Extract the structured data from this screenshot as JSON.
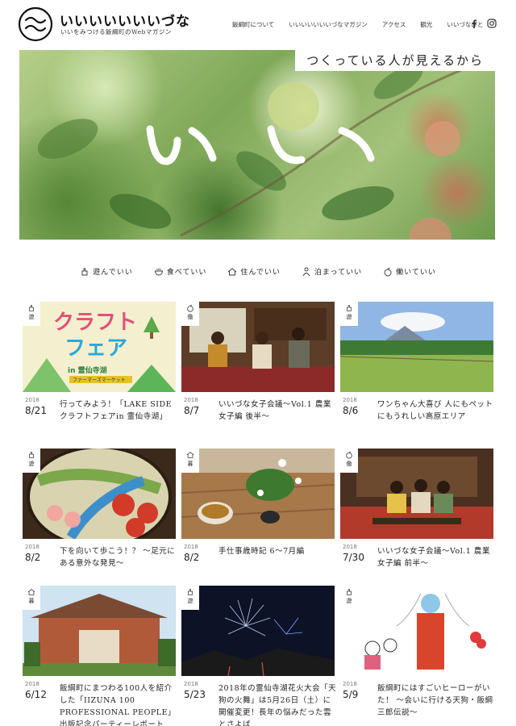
{
  "site": {
    "title": "いいいいいいいづな",
    "subtitle": "いいをみつける飯綱町のWebマガジン"
  },
  "nav": {
    "items": [
      {
        "label": "飯綱町について"
      },
      {
        "label": "いいいいいいいづなマガジン"
      },
      {
        "label": "アクセス"
      },
      {
        "label": "観光"
      },
      {
        "label": "いいづなびと"
      }
    ],
    "social": [
      {
        "icon": "facebook-icon"
      },
      {
        "icon": "instagram-icon"
      }
    ]
  },
  "hero": {
    "tagline": "つくっている人が見えるから",
    "overlay": "いい"
  },
  "categories": [
    {
      "label": "遊んでいい",
      "icon": "hand-icon"
    },
    {
      "label": "食べていい",
      "icon": "bowl-icon"
    },
    {
      "label": "住んでいい",
      "icon": "house-icon"
    },
    {
      "label": "泊まっていい",
      "icon": "person-icon"
    },
    {
      "label": "働いていい",
      "icon": "apple-icon"
    }
  ],
  "articles": [
    {
      "category": "遊",
      "year": "2018",
      "date": "8/21",
      "title": "行ってみよう！「LAKE SIDE クラフトフェアin 霊仙寺湖」",
      "thumb_text": "クラフトフェア",
      "thumb_sub": "in 霊仙寺湖 ファーマーズマーケット"
    },
    {
      "category": "働",
      "year": "2018",
      "date": "8/7",
      "title": "いいづな女子会議～Vol.1 農業女子編 後半～"
    },
    {
      "category": "遊",
      "year": "2018",
      "date": "8/6",
      "title": "ワンちゃん大喜び 人にもペットにもうれしい高原エリア"
    },
    {
      "category": "遊",
      "year": "2018",
      "date": "8/2",
      "title": "下を向いて歩こう！？ ～足元にある意外な発見～"
    },
    {
      "category": "暮",
      "year": "2018",
      "date": "8/2",
      "title": "手仕事歳時記 6～7月編"
    },
    {
      "category": "働",
      "year": "2018",
      "date": "7/30",
      "title": "いいづな女子会議～Vol.1 農業女子編 前半～"
    },
    {
      "category": "暮",
      "year": "2018",
      "date": "6/12",
      "title": "飯綱町にまつわる100人を紹介した「IIZUNA 100 PROFESSIONAL PEOPLE」出版記念パーティーレポート"
    },
    {
      "category": "遊",
      "year": "2018",
      "date": "5/23",
      "title": "2018年の霊仙寺湖花火大会「天狗の火舞」は5月26日（土）に開催変更！長年の悩みだった雲とさよば"
    },
    {
      "category": "遊",
      "year": "2018",
      "date": "5/9",
      "title": "飯綱町にはすごいヒーローがいた！ ～会いに行ける天狗・飯綱三郎伝説～"
    }
  ]
}
